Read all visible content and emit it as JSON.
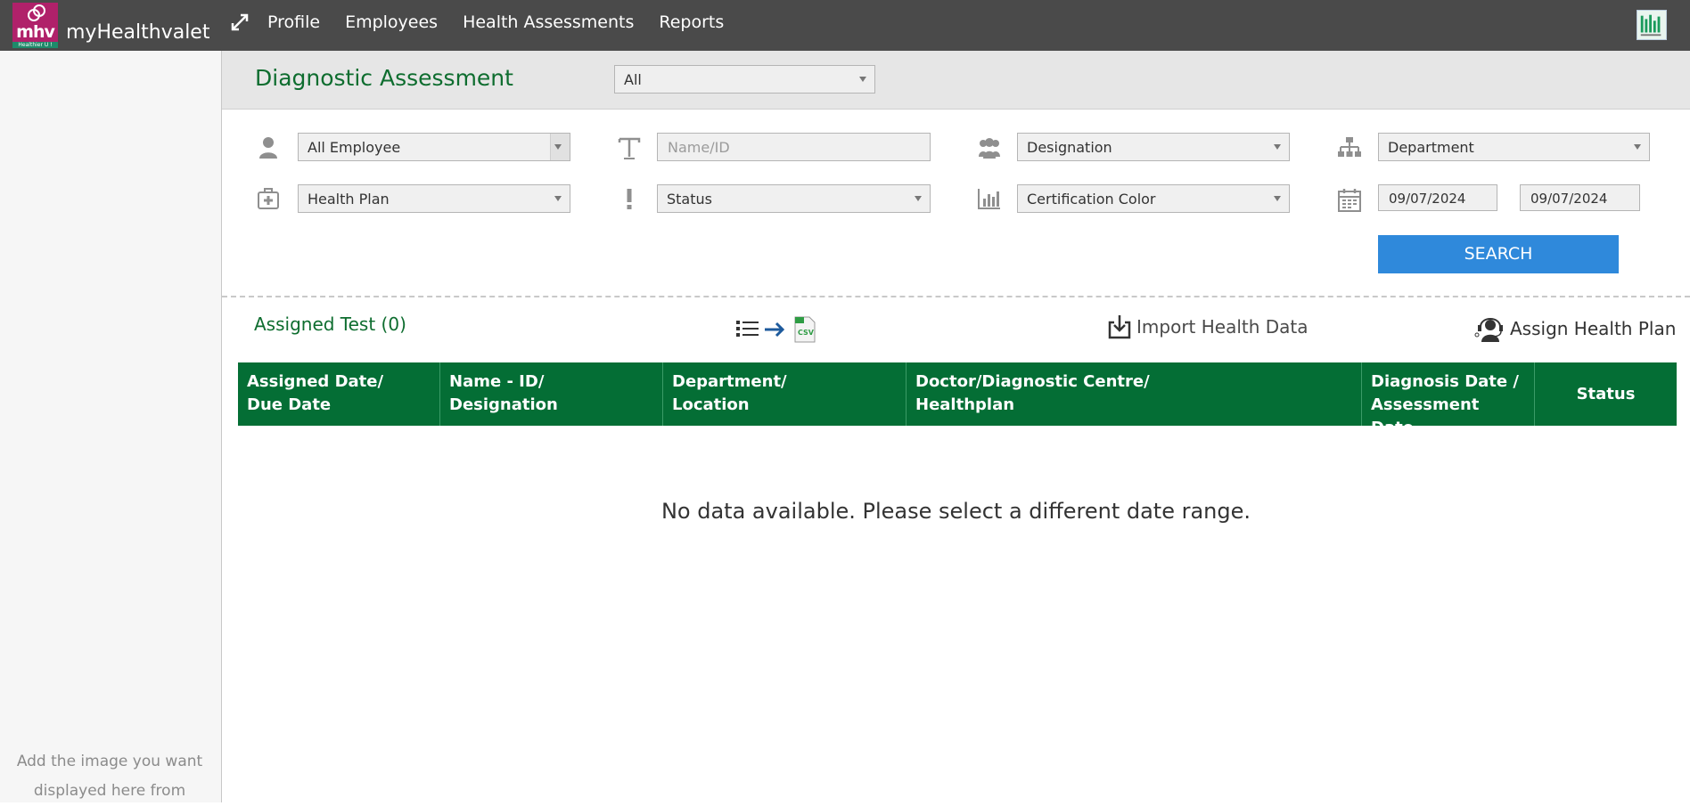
{
  "brand": {
    "logo_text": "mhv",
    "logo_tagline": "Healthier U !",
    "name": "myHealthvalet"
  },
  "nav": {
    "items": [
      "Profile",
      "Employees",
      "Health Assessments",
      "Reports"
    ]
  },
  "sidebar": {
    "hint": "Add the image you want displayed here from"
  },
  "page": {
    "title": "Diagnostic Assessment",
    "scope_select": "All"
  },
  "filters": {
    "employee_select": "All Employee",
    "name_id_placeholder": "Name/ID",
    "designation_select": "Designation",
    "department_select": "Department",
    "health_plan_select": "Health Plan",
    "status_select": "Status",
    "certification_select": "Certification Color",
    "date_from": "09/07/2024",
    "date_to": "09/07/2024",
    "search_label": "SEARCH"
  },
  "section": {
    "assigned_label": "Assigned Test (0)",
    "import_label": "Import Health Data",
    "assign_label": "Assign Health Plan",
    "csv_label": "CSV"
  },
  "table": {
    "columns": [
      [
        "Assigned Date/",
        "Due Date"
      ],
      [
        "Name - ID/",
        "Designation"
      ],
      [
        "Department/",
        "Location"
      ],
      [
        "Doctor/Diagnostic Centre/",
        "Healthplan"
      ],
      [
        "Diagnosis Date /",
        "Assessment Date"
      ],
      [
        "Status"
      ]
    ],
    "empty_message": "No data available. Please select a different date range."
  },
  "colors": {
    "topbar": "#4a4a4a",
    "brand_logo": "#b0216a",
    "accent_green": "#046e35",
    "search_blue": "#2f89db"
  }
}
